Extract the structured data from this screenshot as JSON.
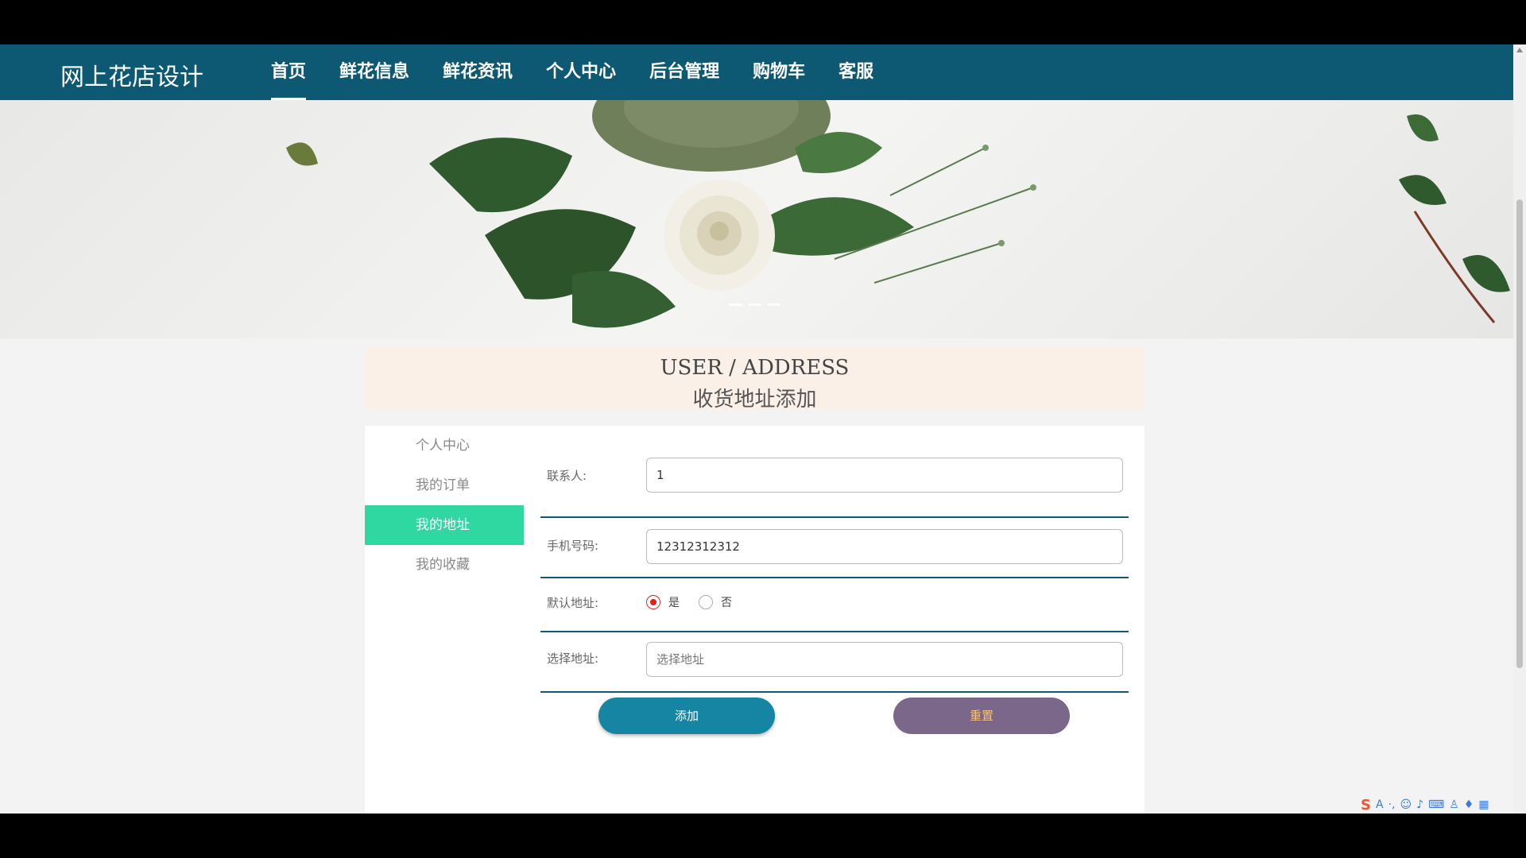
{
  "brand": "网上花店设计",
  "nav": [
    "首页",
    "鲜花信息",
    "鲜花资讯",
    "个人中心",
    "后台管理",
    "购物车",
    "客服"
  ],
  "title": {
    "en": "USER / ADDRESS",
    "cn": "收货地址添加"
  },
  "sidebar": [
    "个人中心",
    "我的订单",
    "我的地址",
    "我的收藏"
  ],
  "form": {
    "contact_label": "联系人:",
    "contact_value": "1",
    "phone_label": "手机号码:",
    "phone_value": "12312312312",
    "default_label": "默认地址:",
    "default_yes": "是",
    "default_no": "否",
    "address_label": "选择地址:",
    "address_placeholder": "选择地址"
  },
  "buttons": {
    "add": "添加",
    "reset": "重置"
  },
  "colors": {
    "navbar": "#0d5873",
    "sidebar_active": "#2ed8a0",
    "add_button": "#1685a4",
    "reset_button": "#7a6789",
    "title_bg": "#fbf0e8"
  }
}
